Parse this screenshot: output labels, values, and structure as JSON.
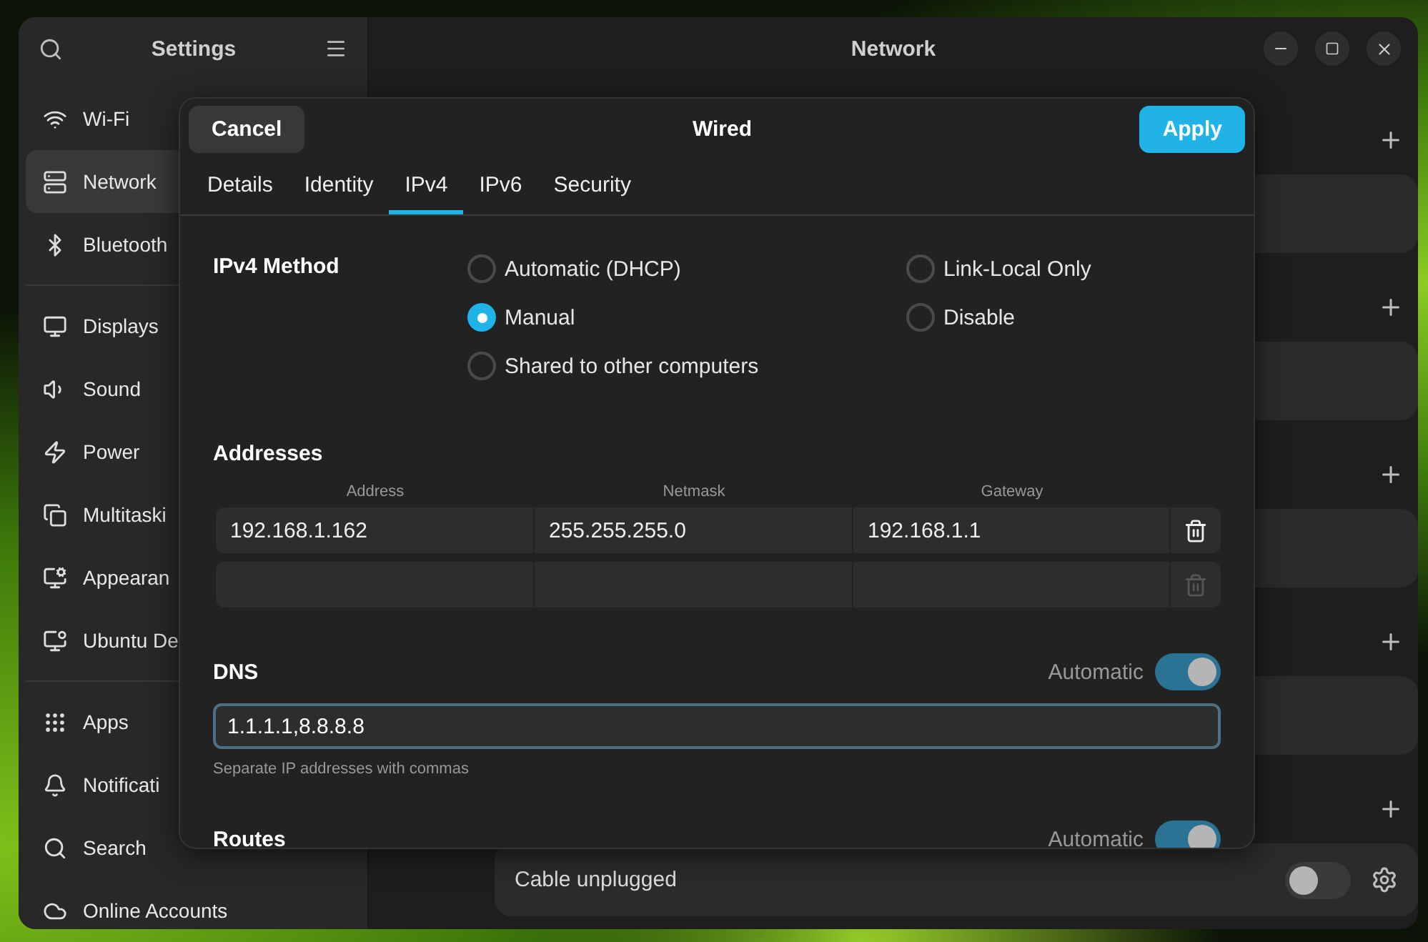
{
  "window": {
    "sidebar_title": "Settings",
    "content_title": "Network"
  },
  "sidebar": {
    "groups": [
      [
        {
          "label": "Wi-Fi",
          "selected": false
        },
        {
          "label": "Network",
          "selected": true
        },
        {
          "label": "Bluetooth",
          "selected": false
        }
      ],
      [
        {
          "label": "Displays",
          "selected": false
        },
        {
          "label": "Sound",
          "selected": false
        },
        {
          "label": "Power",
          "selected": false
        },
        {
          "label": "Multitaski",
          "selected": false
        },
        {
          "label": "Appearan",
          "selected": false
        },
        {
          "label": "Ubuntu De",
          "selected": false
        }
      ],
      [
        {
          "label": "Apps",
          "selected": false
        },
        {
          "label": "Notificati",
          "selected": false
        },
        {
          "label": "Search",
          "selected": false
        },
        {
          "label": "Online Accounts",
          "selected": false
        }
      ]
    ]
  },
  "connection": {
    "label": "Cable unplugged",
    "on": false
  },
  "dialog": {
    "title": "Wired",
    "cancel": "Cancel",
    "apply": "Apply",
    "tabs": [
      {
        "label": "Details",
        "selected": false
      },
      {
        "label": "Identity",
        "selected": false
      },
      {
        "label": "IPv4",
        "selected": true
      },
      {
        "label": "IPv6",
        "selected": false
      },
      {
        "label": "Security",
        "selected": false
      }
    ],
    "method": {
      "label": "IPv4 Method",
      "options": [
        {
          "label": "Automatic (DHCP)",
          "selected": false
        },
        {
          "label": "Manual",
          "selected": true
        },
        {
          "label": "Shared to other computers",
          "selected": false
        },
        {
          "label": "Link-Local Only",
          "selected": false
        },
        {
          "label": "Disable",
          "selected": false
        }
      ]
    },
    "addresses": {
      "heading": "Addresses",
      "columns": [
        "Address",
        "Netmask",
        "Gateway"
      ],
      "rows": [
        {
          "kind": "entry",
          "cells": [
            "192.168.1.162",
            "255.255.255.0",
            "192.168.1.1"
          ]
        },
        {
          "kind": "empty"
        }
      ]
    },
    "dns": {
      "heading": "DNS",
      "toggle_label": "Automatic",
      "automatic": true,
      "value": "1.1.1.1,8.8.8.8",
      "hint": "Separate IP addresses with commas"
    },
    "routes": {
      "heading": "Routes",
      "toggle_label": "Automatic",
      "automatic": true
    }
  }
}
